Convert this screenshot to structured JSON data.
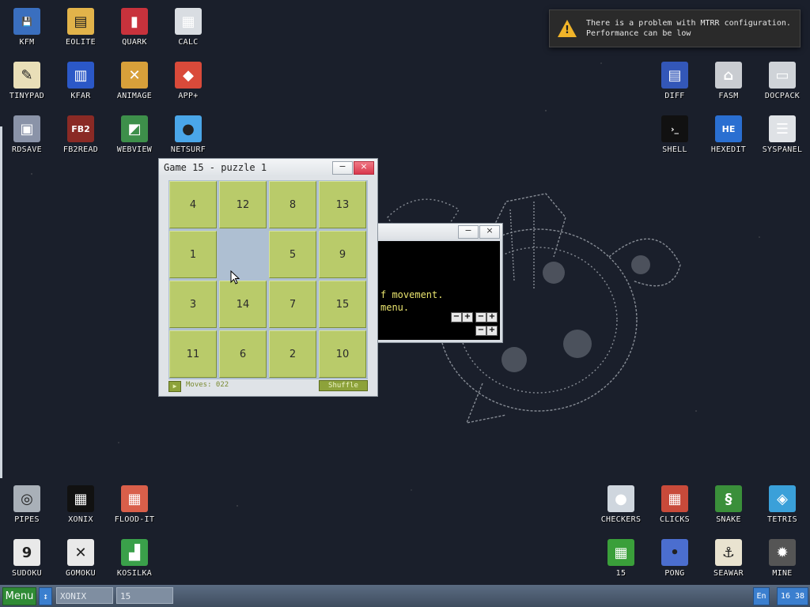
{
  "desktop_icons": [
    {
      "label": "KFM",
      "icon": "floppy-icon"
    },
    {
      "label": "EOLITE",
      "icon": "folder-icon"
    },
    {
      "label": "QUARK",
      "icon": "book-icon"
    },
    {
      "label": "CALC",
      "icon": "calculator-icon"
    },
    {
      "label": "TINYPAD",
      "icon": "notepad-icon"
    },
    {
      "label": "KFAR",
      "icon": "panels-icon"
    },
    {
      "label": "ANIMAGE",
      "icon": "pencil-ruler-icon"
    },
    {
      "label": "APP+",
      "icon": "cube-icon"
    },
    {
      "label": "RDSAVE",
      "icon": "disk-save-icon"
    },
    {
      "label": "FB2READ",
      "icon": "fb2-book-icon"
    },
    {
      "label": "WEBVIEW",
      "icon": "browser-icon"
    },
    {
      "label": "NETSURF",
      "icon": "globe-icon"
    },
    {
      "label": "DIFF",
      "icon": "diff-icon"
    },
    {
      "label": "FASM",
      "icon": "fasm-icon"
    },
    {
      "label": "DOCPACK",
      "icon": "cabinet-icon"
    },
    {
      "label": "SHELL",
      "icon": "terminal-icon"
    },
    {
      "label": "HEXEDIT",
      "icon": "hex-icon"
    },
    {
      "label": "SYSPANEL",
      "icon": "sliders-icon"
    },
    {
      "label": "PIPES",
      "icon": "pipes-icon"
    },
    {
      "label": "XONIX",
      "icon": "xonix-icon"
    },
    {
      "label": "FLOOD-IT",
      "icon": "flood-grid-icon"
    },
    {
      "label": "SUDOKU",
      "icon": "sudoku-icon"
    },
    {
      "label": "GOMOKU",
      "icon": "gomoku-icon"
    },
    {
      "label": "KOSILKA",
      "icon": "lawnmower-icon"
    },
    {
      "label": "CHECKERS",
      "icon": "checkers-icon"
    },
    {
      "label": "CLICKS",
      "icon": "blocks-icon"
    },
    {
      "label": "SNAKE",
      "icon": "snake-icon"
    },
    {
      "label": "TETRIS",
      "icon": "tetris-icon"
    },
    {
      "label": "15",
      "icon": "grid15-icon"
    },
    {
      "label": "PONG",
      "icon": "pong-icon"
    },
    {
      "label": "SEAWAR",
      "icon": "seawar-icon"
    },
    {
      "label": "MINE",
      "icon": "mine-icon"
    }
  ],
  "notification": {
    "text": "There is a problem with MTRR configuration.\nPerformance can be low"
  },
  "console_window": {
    "minimize": "−",
    "close": "×",
    "lines": [
      "f movement.",
      "menu."
    ],
    "plus": "+",
    "minus": "−"
  },
  "game_window": {
    "title": "Game 15 - puzzle 1",
    "minimize": "−",
    "close": "×",
    "tiles": [
      "4",
      "12",
      "8",
      "13",
      "1",
      "",
      "5",
      "9",
      "3",
      "14",
      "7",
      "15",
      "11",
      "6",
      "2",
      "10"
    ],
    "play_glyph": "▶",
    "moves": "Moves: 022",
    "shuffle": "Shuffle"
  },
  "taskbar": {
    "menu": "Menu",
    "arrow": "↕",
    "tasks": [
      "XONIX",
      "15"
    ],
    "lang": "En",
    "clock": "16 38"
  }
}
